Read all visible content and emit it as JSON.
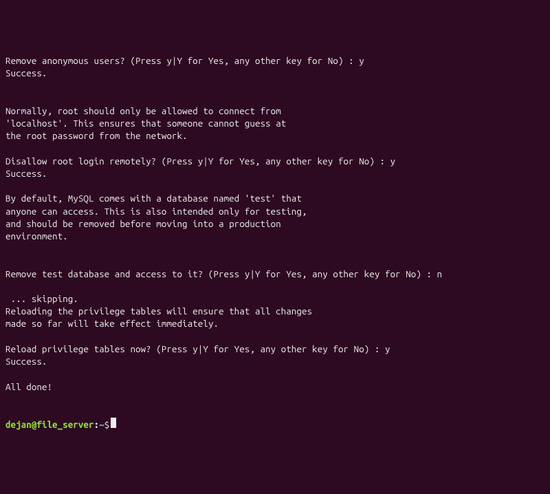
{
  "lines": [
    "Remove anonymous users? (Press y|Y for Yes, any other key for No) : y",
    "Success.",
    "",
    "",
    "Normally, root should only be allowed to connect from",
    "'localhost'. This ensures that someone cannot guess at",
    "the root password from the network.",
    "",
    "Disallow root login remotely? (Press y|Y for Yes, any other key for No) : y",
    "Success.",
    "",
    "By default, MySQL comes with a database named 'test' that",
    "anyone can access. This is also intended only for testing,",
    "and should be removed before moving into a production",
    "environment.",
    "",
    "",
    "Remove test database and access to it? (Press y|Y for Yes, any other key for No) : n",
    "",
    " ... skipping.",
    "Reloading the privilege tables will ensure that all changes",
    "made so far will take effect immediately.",
    "",
    "Reload privilege tables now? (Press y|Y for Yes, any other key for No) : y",
    "Success.",
    "",
    "All done!"
  ],
  "prompt": {
    "user": "dejan",
    "at": "@",
    "host": "file_server",
    "colon": ":",
    "path": "~",
    "symbol": "$"
  }
}
